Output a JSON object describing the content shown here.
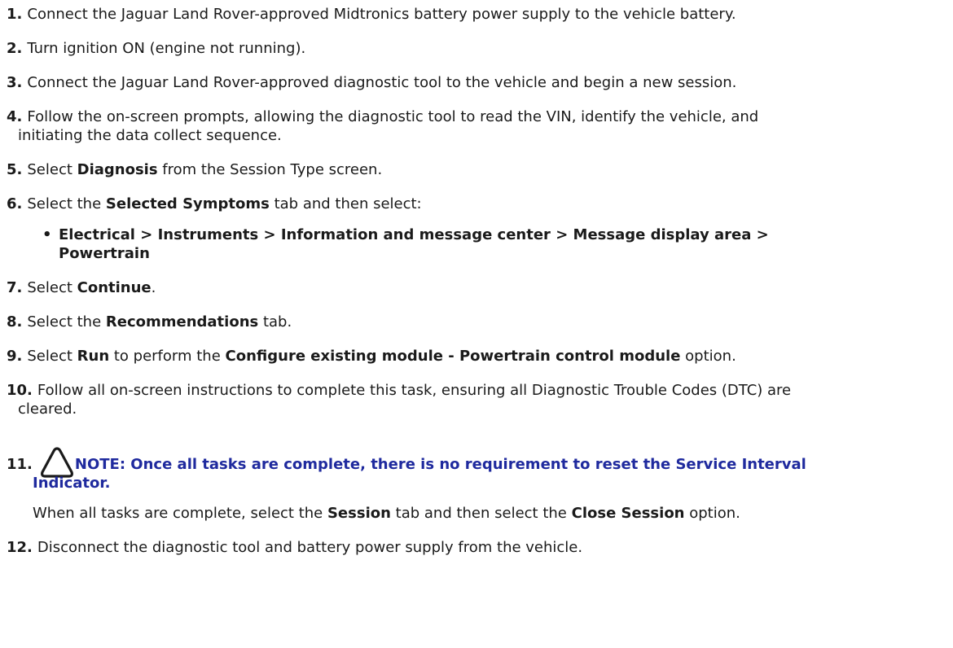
{
  "steps": [
    {
      "num": "1.",
      "text": "Connect the Jaguar Land Rover-approved Midtronics battery power supply to the vehicle battery."
    },
    {
      "num": "2.",
      "text": "Turn ignition ON (engine not running)."
    },
    {
      "num": "3.",
      "text": "Connect the Jaguar Land Rover-approved diagnostic tool to the vehicle and begin a new session."
    },
    {
      "num": "4.",
      "line1": "Follow the on-screen prompts, allowing the diagnostic tool to read the VIN, identify the vehicle, and",
      "line2": "initiating the data collect sequence."
    },
    {
      "num": "5.",
      "pre": "Select ",
      "bold": "Diagnosis",
      "post": " from the Session Type screen."
    },
    {
      "num": "6.",
      "pre": "Select the ",
      "bold": "Selected Symptoms",
      "post": " tab and then select:"
    },
    {
      "num": "7.",
      "pre": "Select ",
      "bold": "Continue",
      "post": "."
    },
    {
      "num": "8.",
      "pre": "Select the ",
      "bold": "Recommendations",
      "post": " tab."
    },
    {
      "num": "9.",
      "pre": "Select ",
      "bold": "Run",
      "mid": " to perform the ",
      "bold2": "Configure existing module - Powertrain control module",
      "post": " option."
    },
    {
      "num": "10.",
      "line1": "Follow all on-screen instructions to complete this task, ensuring all Diagnostic Trouble Codes (DTC) are",
      "line2": "cleared."
    },
    {
      "num": "11.",
      "note_line1": "NOTE: Once all tasks are complete, there is no requirement to reset the Service Interval",
      "note_line2": "Indicator.",
      "pre": "When all tasks are complete, select the ",
      "bold": "Session",
      "mid": " tab and then select the ",
      "bold2": "Close Session",
      "post": " option."
    },
    {
      "num": "12.",
      "text": "Disconnect the diagnostic tool and battery power supply from the vehicle."
    }
  ],
  "symptom_path": {
    "bullet": "•",
    "line1": "Electrical > Instruments > Information and message center > Message display area >",
    "line2": "Powertrain"
  },
  "colors": {
    "note_text": "#1f2a9e",
    "body_text": "#1a1a1a"
  },
  "icons": {
    "note": "warning-triangle-outline-icon"
  }
}
